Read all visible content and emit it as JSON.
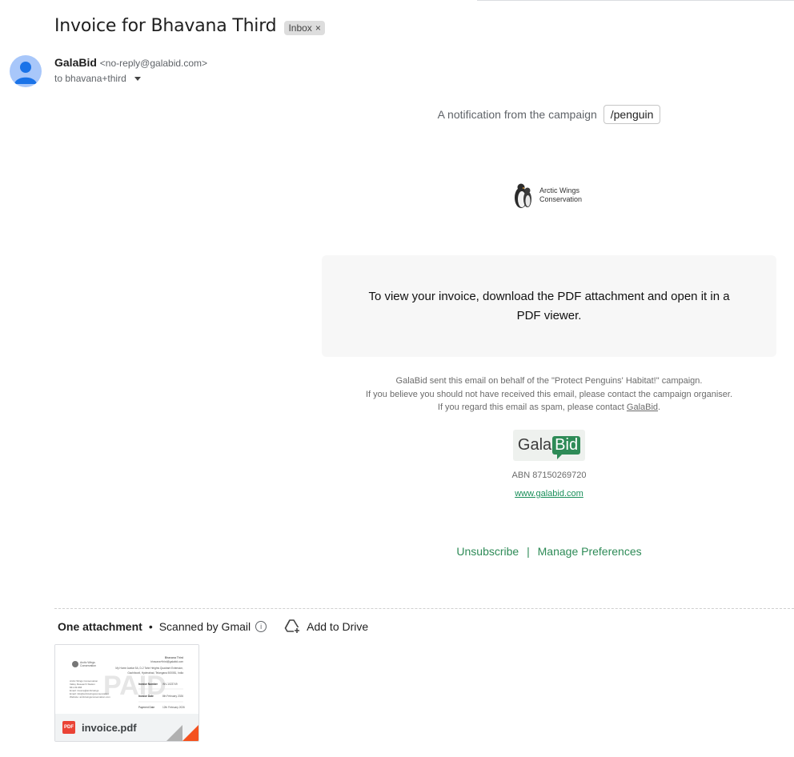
{
  "subject": {
    "title": "Invoice for Bhavana Third",
    "label_chip": "Inbox",
    "chip_close": "×"
  },
  "sender": {
    "name": "GalaBid",
    "email": "<no-reply@galabid.com>",
    "to_line": "to bhavana+third"
  },
  "email": {
    "notification_prefix": "A notification from the campaign",
    "campaign_slug": "/penguin",
    "org_name_line1": "Arctic Wings",
    "org_name_line2": "Conservation",
    "box_text": "To view your invoice, download the PDF attachment and open it in a PDF viewer.",
    "footer_line1": "GalaBid sent this email on behalf of the \"Protect Penguins' Habitat!\" campaign.",
    "footer_line2": "If you believe you should not have received this email, please contact the campaign organiser.",
    "footer_line3_prefix": "If you regard this email as spam, please contact",
    "footer_line3_link": "GalaBid",
    "footer_line3_suffix": ".",
    "logo_gala": "Gala",
    "logo_bid": "Bid",
    "abn": "ABN 87150269720",
    "website": "www.galabid.com",
    "unsubscribe": "Unsubscribe",
    "separator": "|",
    "manage_preferences": "Manage Preferences"
  },
  "attachments": {
    "count_label": "One attachment",
    "dot": "•",
    "scanned": "Scanned by Gmail",
    "info_glyph": "i",
    "add_to_drive": "Add to Drive",
    "file_name": "invoice.pdf",
    "file_badge": "PDF",
    "preview": {
      "name": "Bhavana Third",
      "email": "bhavana+third@galabid.com",
      "address1": "My Home Avatar 5A, D-2 Tahir Heights Quadrant Extension,",
      "address2": "Gachibowli, Hyderabad, Telangana 500081, India",
      "org_lines": [
        "Arctic Wings Conservation",
        "Valley Research Station",
        "841-03-966",
        "Email: invoice@arcticwings",
        "Email: info@arcticwingsconservation",
        "Website: arcticwingsconservation.com"
      ],
      "invoice_label": "Invoice Number",
      "invoice_value": "INV-1023749",
      "date_label": "Invoice Date",
      "date_value": "8th February 2026",
      "due_label": "Payment Date",
      "due_value": "12th February 2026",
      "stamp": "PAID"
    }
  }
}
